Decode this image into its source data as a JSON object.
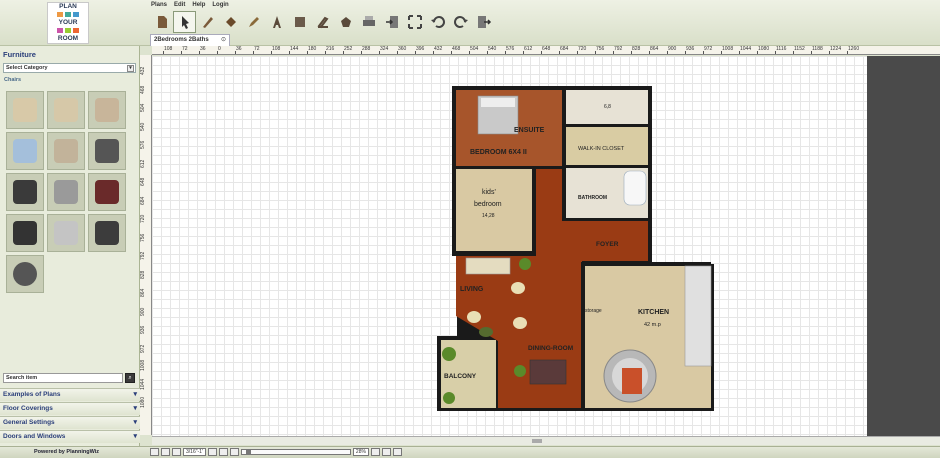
{
  "logo": {
    "lines": [
      "PLAN",
      "YOUR",
      "ROOM"
    ]
  },
  "menu": [
    "Plans",
    "Edit",
    "Help",
    "Login"
  ],
  "toolbar": {
    "icons": [
      "document-icon",
      "pointer-icon",
      "wall-tool-icon",
      "paint-icon",
      "pencil-icon",
      "text-icon",
      "fill-icon",
      "wall-draw-icon",
      "bucket-icon",
      "print-icon",
      "import-icon",
      "fullscreen-icon",
      "undo-icon",
      "redo-icon",
      "export-icon"
    ]
  },
  "left": {
    "title": "Furniture",
    "category_select": "Select Category",
    "subcategory": "Chairs",
    "search_label": "Search item",
    "accordion": [
      "Examples of Plans",
      "Floor Coverings",
      "General Settings",
      "Doors and Windows"
    ],
    "chair_colors": [
      "#d8c9a8",
      "#d6c8a8",
      "#c8b59a",
      "#a4bfdb",
      "#c2b39a",
      "#555555",
      "#3a3a3a",
      "#9a9a9a",
      "#6a2a2a",
      "#333333",
      "#c4c4c4",
      "#3c3c3c",
      "#555555"
    ]
  },
  "tab": {
    "title": "2Bedrooms 2Baths",
    "close": "⊙"
  },
  "ruler": {
    "h": [
      "108",
      "72",
      "36",
      "0",
      "36",
      "72",
      "108",
      "144",
      "180",
      "216",
      "252",
      "288",
      "324",
      "360",
      "396",
      "432",
      "468",
      "504",
      "540",
      "576",
      "612",
      "648",
      "684",
      "720",
      "756",
      "792",
      "828",
      "864",
      "900",
      "936",
      "972",
      "1008",
      "1044",
      "1080",
      "1116",
      "1152",
      "1188",
      "1224",
      "1260"
    ],
    "v": [
      "432",
      "468",
      "504",
      "540",
      "576",
      "612",
      "648",
      "684",
      "720",
      "756",
      "792",
      "828",
      "864",
      "900",
      "936",
      "972",
      "1008",
      "1044",
      "1080"
    ]
  },
  "rooms": {
    "ensuite": "ENSUITE",
    "bedroom": "BEDROOM 6X4 II",
    "bath_small": "6,8",
    "walkin": "WALK-IN CLOSET",
    "bathroom": "BATHROOM",
    "kids1": "kids'",
    "kids2": "bedroom",
    "kids_area": "14,28",
    "foyer": "FOYER",
    "living": "LIVING",
    "kitchen": "KITCHEN",
    "kitchen_area": "42 m.p",
    "storage": "storage",
    "dining": "DINING-ROOM",
    "balcony": "BALCONY"
  },
  "status": {
    "powered": "Powered by PlanningWiz",
    "scale": "3/16\"-1'",
    "zoom": "28%"
  },
  "colors": {
    "floor_dark": "#9a3b14",
    "floor_light": "#d9c9a3",
    "tile": "#e7e2d5",
    "wall": "#1a1a1a"
  }
}
